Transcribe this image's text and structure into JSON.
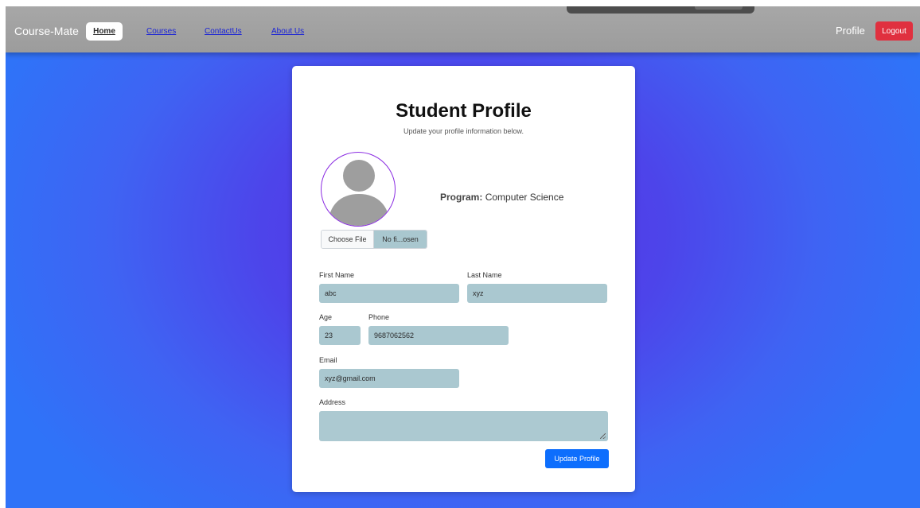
{
  "navbar": {
    "brand": "Course-Mate",
    "links": {
      "home": "Home",
      "courses": "Courses",
      "contact": "ContactUs",
      "about": "About Us"
    },
    "profile": "Profile",
    "logout": "Logout"
  },
  "card": {
    "title": "Student Profile",
    "subtitle": "Update your profile information below.",
    "program_label": "Program:",
    "program_value": "Computer Science",
    "file_input": {
      "button": "Choose File",
      "status": "No fi...osen"
    },
    "fields": {
      "first_name": {
        "label": "First Name",
        "value": "abc"
      },
      "last_name": {
        "label": "Last Name",
        "value": "xyz"
      },
      "age": {
        "label": "Age",
        "value": "23"
      },
      "phone": {
        "label": "Phone",
        "value": "9687062562"
      },
      "email": {
        "label": "Email",
        "value": "xyz@gmail.com"
      },
      "address": {
        "label": "Address",
        "value": ""
      }
    },
    "submit": "Update Profile"
  },
  "colors": {
    "accent": "#0d6efd",
    "danger": "#e0303f",
    "field_bg": "#aac8d0",
    "avatar_border": "#8a2be2"
  }
}
